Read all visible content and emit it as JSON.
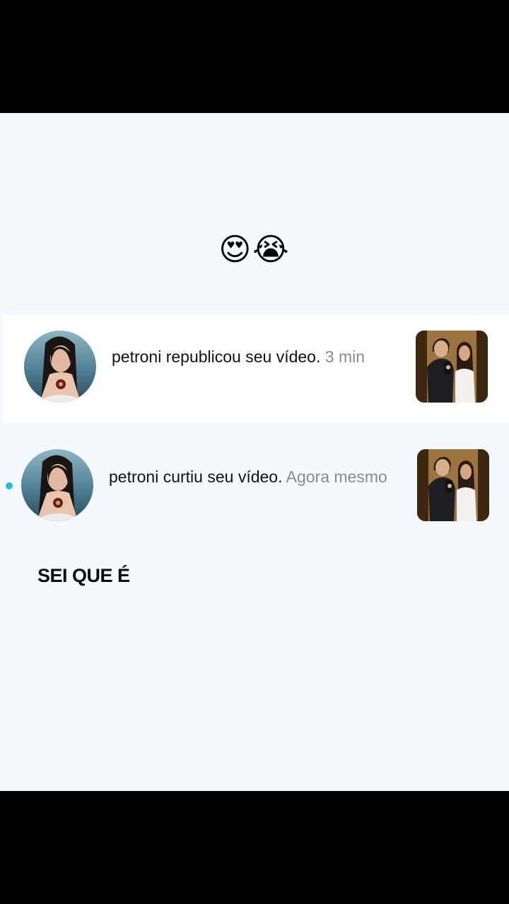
{
  "reaction_emojis": "😍😭",
  "notifications": [
    {
      "message": "petroni republicou seu vídeo.",
      "time": "3 min",
      "avatar_icon": "profile-photo-woman-dark-hair",
      "thumbnail_icon": "video-thumbnail-couple-mirror-selfie",
      "unread": false
    },
    {
      "message": "petroni curtiu seu vídeo.",
      "time": "Agora mesmo",
      "avatar_icon": "profile-photo-woman-dark-hair",
      "thumbnail_icon": "video-thumbnail-couple-mirror-selfie",
      "unread": true
    }
  ],
  "caption": "SEI QUE É",
  "colors": {
    "background": "#f4f9fd",
    "card_highlight": "#ffffff",
    "unread_dot": "#2ab7dc",
    "time_text": "#8a8a8a"
  }
}
